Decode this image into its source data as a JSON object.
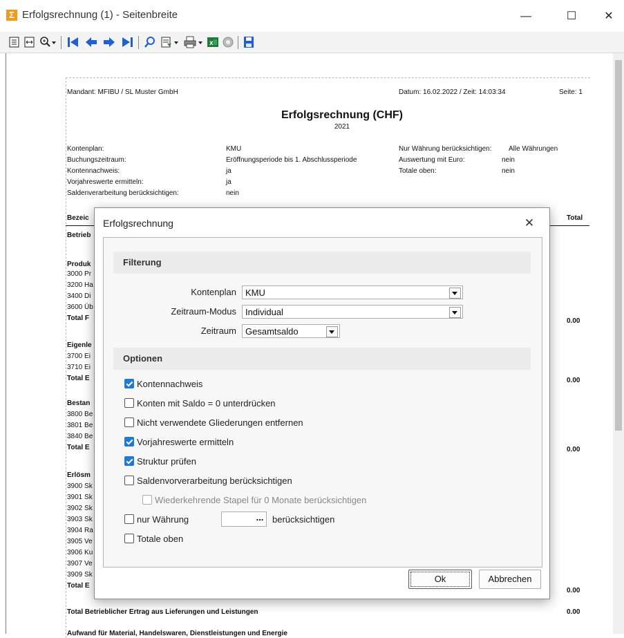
{
  "window": {
    "title": "Erfolgsrechnung (1) - Seitenbreite",
    "app_icon": "sum-icon",
    "minimize": "—",
    "maximize": "☐",
    "close": "✕"
  },
  "toolbar": {
    "icons": [
      "page-view-icon",
      "page-width-icon",
      "zoom-icon",
      "first-page-icon",
      "prev-page-icon",
      "next-page-icon",
      "last-page-icon",
      "search-icon",
      "export-icon",
      "print-icon",
      "excel-icon",
      "email-icon",
      "save-icon"
    ]
  },
  "report": {
    "mandant": "Mandant: MFIBU / SL Muster GmbH",
    "datum": "Datum: 16.02.2022 / Zeit: 14:03:34",
    "seite": "Seite: 1",
    "title": "Erfolgsrechnung (CHF)",
    "year": "2021",
    "params": [
      {
        "label": "Kontenplan:",
        "value": "KMU"
      },
      {
        "label": "Buchungszeitraum:",
        "value": "Eröffnungsperiode bis 1. Abschlussperiode"
      },
      {
        "label": "Kontennachweis:",
        "value": "ja"
      },
      {
        "label": "Vorjahreswerte ermitteln:",
        "value": "ja"
      },
      {
        "label": "Saldenverarbeitung berücksichtigen:",
        "value": "nein"
      }
    ],
    "params_right": [
      {
        "label": "Nur Währung berücksichtigen:",
        "value": "Alle Währungen"
      },
      {
        "label": "Auswertung mit Euro:",
        "value": "nein"
      },
      {
        "label": "Totale oben:",
        "value": "nein"
      }
    ],
    "col_bez": "Bezeic",
    "col_total": "Total",
    "rows": [
      {
        "t": "Betrieb",
        "b": true
      },
      {
        "t": "Produk",
        "b": true
      },
      {
        "t": "3000 Pr",
        "b": false
      },
      {
        "t": "3200 Ha",
        "b": false
      },
      {
        "t": "3400 Di",
        "b": false
      },
      {
        "t": "3600 Üb",
        "b": false
      },
      {
        "t": "Total  F",
        "b": true
      },
      {
        "t": "Eigenle",
        "b": true
      },
      {
        "t": "3700 Ei",
        "b": false
      },
      {
        "t": "3710 Ei",
        "b": false
      },
      {
        "t": "Total  E",
        "b": true
      },
      {
        "t": "Bestan",
        "b": true
      },
      {
        "t": "3800 Be",
        "b": false
      },
      {
        "t": "3801 Be",
        "b": false
      },
      {
        "t": "3840 Be",
        "b": false
      },
      {
        "t": "Total  E",
        "b": true
      },
      {
        "t": "Erlösm",
        "b": true
      },
      {
        "t": "3900 Sk",
        "b": false
      },
      {
        "t": "3901 Sk",
        "b": false
      },
      {
        "t": "3902 Sk",
        "b": false
      },
      {
        "t": "3903 Sk",
        "b": false
      },
      {
        "t": "3904 Ra",
        "b": false
      },
      {
        "t": "3905 Ve",
        "b": false
      },
      {
        "t": "3906 Ku",
        "b": false
      },
      {
        "t": "3907 Ve",
        "b": false
      },
      {
        "t": "3909 Sk",
        "b": false
      },
      {
        "t": "Total  E",
        "b": true
      }
    ],
    "totals": [
      "0.00",
      "0.00",
      "0.00",
      "0.00",
      "0.00"
    ],
    "total_line": "Total  Betrieblicher Ertrag aus Lieferungen und Leistungen",
    "total_line_value": "0.00",
    "cut_line": "Aufwand für Material, Handelswaren, Dienstleistungen und Energie"
  },
  "dialog": {
    "title": "Erfolgsrechnung",
    "close": "✕",
    "section_filter": "Filterung",
    "kontenplan_label": "Kontenplan",
    "kontenplan_value": "KMU",
    "zeitraum_modus_label": "Zeitraum-Modus",
    "zeitraum_modus_value": "Individual",
    "zeitraum_label": "Zeitraum",
    "zeitraum_value": "Gesamtsaldo",
    "section_options": "Optionen",
    "options": {
      "kontennachweis": {
        "label": "Kontennachweis",
        "checked": true
      },
      "saldo_null": {
        "label": "Konten mit Saldo = 0 unterdrücken",
        "checked": false
      },
      "gliederungen": {
        "label": "Nicht verwendete Gliederungen entfernen",
        "checked": false
      },
      "vorjahr": {
        "label": "Vorjahreswerte ermitteln",
        "checked": true
      },
      "struktur": {
        "label": "Struktur prüfen",
        "checked": true
      },
      "saldenvor": {
        "label": "Saldenvorverarbeitung berücksichtigen",
        "checked": false
      },
      "stapel": {
        "label": "Wiederkehrende Stapel für 0 Monate berücksichtigen",
        "checked": false
      },
      "nur_waehrung": {
        "label": "nur Währung",
        "checked": false
      },
      "beruecksichtigen": "berücksichtigen",
      "totale_oben": {
        "label": "Totale oben",
        "checked": false
      }
    },
    "dots": "...",
    "ok": "Ok",
    "cancel": "Abbrechen"
  }
}
